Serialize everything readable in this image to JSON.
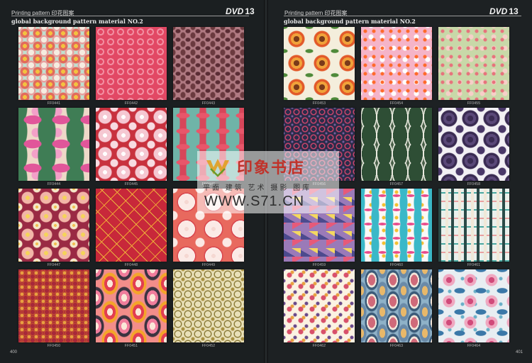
{
  "left": {
    "header": "Printing pattern 印花图案",
    "dvd_label": "DVD",
    "dvd_number": "13",
    "subtitle": "global background pattern material NO.2",
    "page_number": "400",
    "swatches": [
      {
        "code": "FF0441",
        "pattern": "circles-mint"
      },
      {
        "code": "FF0442",
        "pattern": "swirl-pink"
      },
      {
        "code": "FF0443",
        "pattern": "leopard-mauve"
      },
      {
        "code": "FF0444",
        "pattern": "tropical-pink"
      },
      {
        "code": "FF0445",
        "pattern": "hibiscus-red"
      },
      {
        "code": "FF0446",
        "pattern": "lily-coral"
      },
      {
        "code": "FF0447",
        "pattern": "blossom-maroon"
      },
      {
        "code": "FF0448",
        "pattern": "leaf-red-gold"
      },
      {
        "code": "FF0449",
        "pattern": "flower-salmon"
      },
      {
        "code": "FF0450",
        "pattern": "damask-red"
      },
      {
        "code": "FF0451",
        "pattern": "retro-drops"
      },
      {
        "code": "FF0452",
        "pattern": "scroll-olive"
      }
    ]
  },
  "right": {
    "header": "Printing pattern 印花图案",
    "dvd_label": "DVD",
    "dvd_number": "13",
    "subtitle": "global background pattern material NO.2",
    "page_number": "401",
    "swatches": [
      {
        "code": "FF0453",
        "pattern": "sunflower-cream"
      },
      {
        "code": "FF0454",
        "pattern": "floral-pink"
      },
      {
        "code": "FF0455",
        "pattern": "floral-sage"
      },
      {
        "code": "FF0456",
        "pattern": "lace-navy"
      },
      {
        "code": "FF0457",
        "pattern": "leaf-green"
      },
      {
        "code": "FF0458",
        "pattern": "chrysanthemum-purple"
      },
      {
        "code": "FF0459",
        "pattern": "geometric-purple"
      },
      {
        "code": "FF0460",
        "pattern": "doodle-white"
      },
      {
        "code": "FF0461",
        "pattern": "brush-teal"
      },
      {
        "code": "FF0462",
        "pattern": "ditsy-cream"
      },
      {
        "code": "FF0463",
        "pattern": "paisley-blue"
      },
      {
        "code": "FF0464",
        "pattern": "bird-floral"
      }
    ]
  },
  "watermark": {
    "name": "印象书店",
    "tagline": "平面 建筑 艺术 摄影 图库",
    "url": "WWW.S71.CN"
  },
  "colors": {
    "background": "#1b1f21",
    "text": "#d8d8d8",
    "watermark_red": "#c0322a"
  }
}
